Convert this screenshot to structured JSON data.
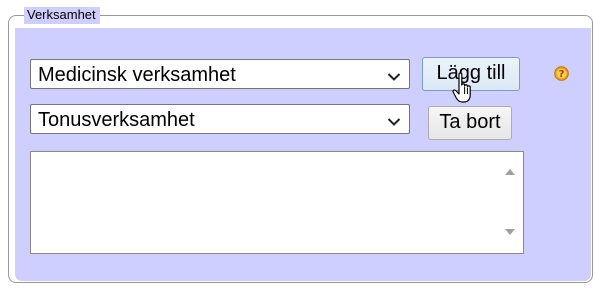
{
  "fieldset": {
    "legend": "Verksamhet",
    "background": "#cfcfff"
  },
  "selects": [
    {
      "value": "Medicinsk verksamhet"
    },
    {
      "value": "Tonusverksamhet"
    }
  ],
  "buttons": {
    "add_label": "Lägg till",
    "remove_label": "Ta bort"
  },
  "icons": {
    "help": "help-icon",
    "dropdown": "chevron-down-icon",
    "cursor": "hand-pointer-icon"
  }
}
